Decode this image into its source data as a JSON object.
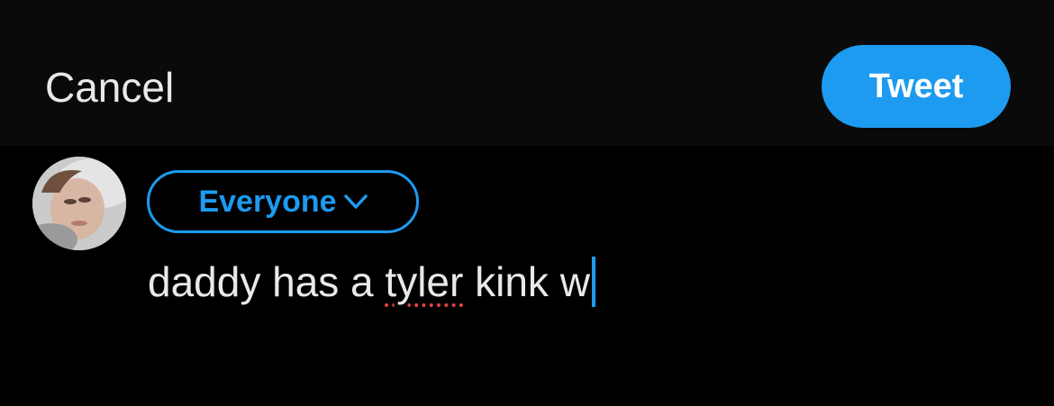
{
  "header": {
    "cancel_label": "Cancel",
    "tweet_label": "Tweet"
  },
  "composer": {
    "audience_label": "Everyone",
    "audience_icon": "chevron-down-icon",
    "text_before": "daddy has a ",
    "misspelled_word": "tyler",
    "text_after": " kink w",
    "avatar_icon": "user-avatar"
  },
  "colors": {
    "accent": "#1d9bf0",
    "background": "#000000",
    "header_background": "#0a0a0a",
    "text": "#e7e9ea",
    "spellcheck": "#e0433a"
  }
}
